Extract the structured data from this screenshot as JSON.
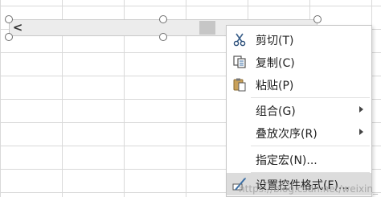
{
  "menu": {
    "items": [
      {
        "label": "剪切(T)",
        "icon": "scissors-icon"
      },
      {
        "label": "复制(C)",
        "icon": "copy-icon"
      },
      {
        "label": "粘贴(P)",
        "icon": "paste-icon"
      },
      {
        "label": "组合(G)",
        "submenu": true
      },
      {
        "label": "叠放次序(R)",
        "submenu": true
      },
      {
        "label": "指定宏(N)..."
      },
      {
        "label": "设置控件格式(F)...",
        "icon": "format-control-icon",
        "highlighted": true
      }
    ]
  },
  "scrollbar": {
    "left_arrow": "<"
  },
  "watermark": "https://blog.csdn.net/weixin_"
}
